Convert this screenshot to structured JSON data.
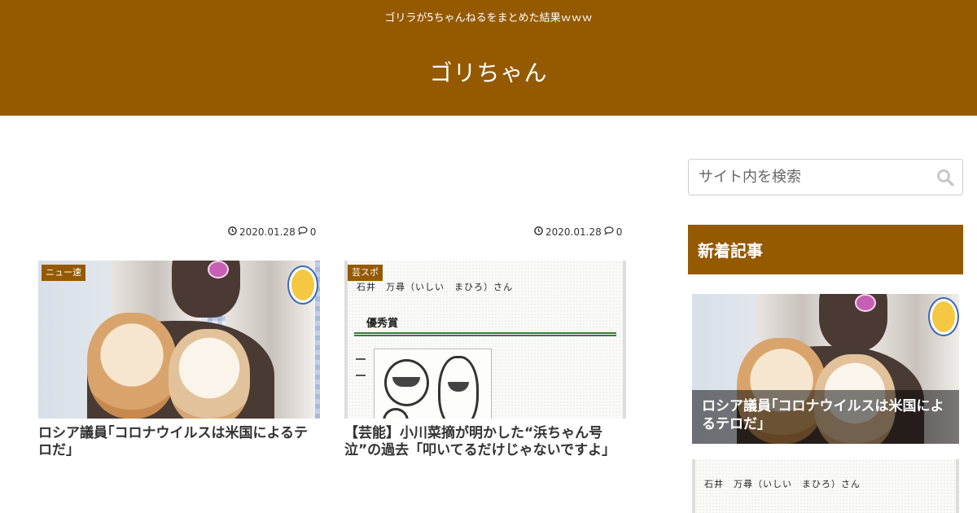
{
  "header": {
    "tagline": "ゴリラが5ちゃんねるをまとめた結果ｗｗｗ",
    "site_title": "ゴリちゃん",
    "background_color": "#955900"
  },
  "articles": [
    {
      "category": "ニュー速",
      "title": "ロシア議員｢コロナウイルスは米国によるテロだ｣",
      "date": "2020.01.28",
      "comments": "0",
      "thumbnail": "photo-woman-with-chihuahuas"
    },
    {
      "category": "芸スポ",
      "title": "【芸能】小川菜摘が明かした“浜ちゃん号泣”の過去「叩いてるだけじゃないですよ」",
      "date": "2020.01.28",
      "comments": "0",
      "thumbnail": "award-certificate-with-drawing",
      "thumb_text": {
        "name_line": "石井　万尋（いしい　まひろ）さん",
        "award": "優秀賞"
      }
    }
  ],
  "sidebar": {
    "search_placeholder": "サイト内を検索",
    "widget_title": "新着記事",
    "recent": [
      {
        "title": "ロシア議員｢コロナウイルスは米国によるテロだ｣"
      },
      {
        "name_line": "石井　万尋（いしい　まひろ）さん"
      }
    ]
  },
  "icons": {
    "date": "clock-icon",
    "comments": "comment-icon",
    "search": "search-icon"
  }
}
